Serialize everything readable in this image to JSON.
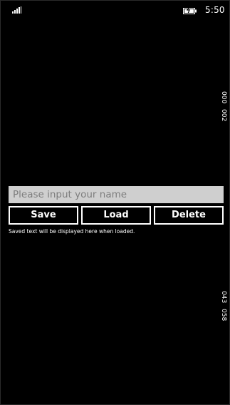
{
  "status_bar": {
    "signal_icon": "signal-strength-icon",
    "battery_icon": "battery-charging-icon",
    "time": "5:50"
  },
  "debug_counters": {
    "top": [
      "000",
      "002"
    ],
    "bottom": [
      "043",
      "058"
    ]
  },
  "form": {
    "name_input": {
      "value": "",
      "placeholder": "Please input your name"
    },
    "buttons": {
      "save": "Save",
      "load": "Load",
      "delete": "Delete"
    },
    "saved_text": "Saved text will be displayed here when loaded."
  },
  "colors": {
    "background": "#000000",
    "input_background": "#cfcfcf",
    "button_border": "#ffffff"
  }
}
